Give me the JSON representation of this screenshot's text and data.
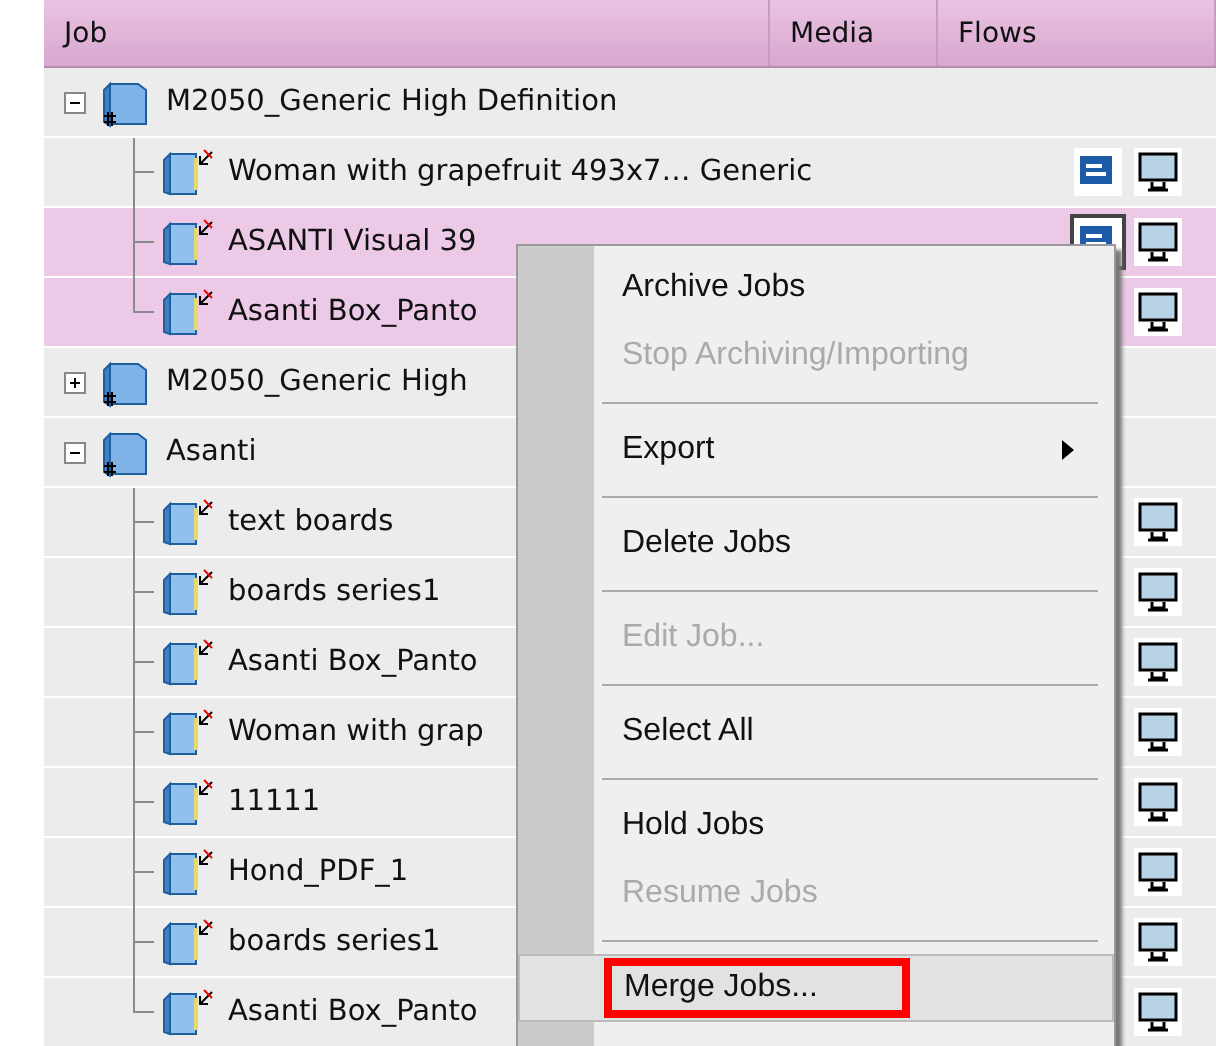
{
  "table": {
    "columns": [
      {
        "label": "Job"
      },
      {
        "label": "Media"
      },
      {
        "label": "Flows"
      }
    ],
    "rows": [
      {
        "name": "M2050_Generic High Definition",
        "expanded": true,
        "selected": false,
        "children": [
          {
            "name": "Woman with grapefruit 493x7… Generic",
            "selected": false,
            "flows": [
              {
                "kind": "ticket",
                "focused": false
              },
              {
                "kind": "monitor"
              }
            ]
          },
          {
            "name": "ASANTI Visual 39",
            "selected": true,
            "flows": [
              {
                "kind": "ticket",
                "focused": true
              },
              {
                "kind": "monitor"
              }
            ]
          },
          {
            "name": "Asanti Box_Panto",
            "selected": true,
            "flows": [
              {
                "kind": "monitor"
              }
            ]
          }
        ]
      },
      {
        "name": "M2050_Generic High",
        "expanded": false,
        "selected": false
      },
      {
        "name": "Asanti",
        "expanded": true,
        "selected": false,
        "children": [
          {
            "name": "text boards",
            "selected": false,
            "flows": [
              {
                "kind": "monitor"
              }
            ]
          },
          {
            "name": "boards series1",
            "selected": false,
            "flows": [
              {
                "kind": "monitor"
              }
            ]
          },
          {
            "name": "Asanti Box_Panto",
            "selected": false,
            "flows": [
              {
                "kind": "monitor"
              }
            ]
          },
          {
            "name": "Woman with grap",
            "selected": false,
            "flows": [
              {
                "kind": "monitor"
              }
            ]
          },
          {
            "name": "11111",
            "selected": false,
            "flows": [
              {
                "kind": "monitor"
              }
            ]
          },
          {
            "name": "Hond_PDF_1",
            "selected": false,
            "flows": [
              {
                "kind": "monitor"
              }
            ]
          },
          {
            "name": "boards series1",
            "selected": false,
            "flows": [
              {
                "kind": "monitor"
              }
            ]
          },
          {
            "name": "Asanti Box_Panto",
            "selected": false,
            "flows": [
              {
                "kind": "monitor"
              }
            ]
          }
        ]
      }
    ]
  },
  "context_menu": {
    "items": [
      {
        "kind": "item",
        "label": "Archive Jobs",
        "disabled": false,
        "submenu": false,
        "highlighted": false
      },
      {
        "kind": "item",
        "label": "Stop Archiving/Importing",
        "disabled": true,
        "submenu": false,
        "highlighted": false
      },
      {
        "kind": "separator"
      },
      {
        "kind": "item",
        "label": "Export",
        "disabled": false,
        "submenu": true,
        "highlighted": false
      },
      {
        "kind": "separator"
      },
      {
        "kind": "item",
        "label": "Delete Jobs",
        "disabled": false,
        "submenu": false,
        "highlighted": false
      },
      {
        "kind": "separator"
      },
      {
        "kind": "item",
        "label": "Edit Job...",
        "disabled": true,
        "submenu": false,
        "highlighted": false
      },
      {
        "kind": "separator"
      },
      {
        "kind": "item",
        "label": "Select All",
        "disabled": false,
        "submenu": false,
        "highlighted": false
      },
      {
        "kind": "separator"
      },
      {
        "kind": "item",
        "label": "Hold Jobs",
        "disabled": false,
        "submenu": false,
        "highlighted": false
      },
      {
        "kind": "item",
        "label": "Resume Jobs",
        "disabled": true,
        "submenu": false,
        "highlighted": false
      },
      {
        "kind": "separator"
      },
      {
        "kind": "item",
        "label": "Merge Jobs...",
        "disabled": false,
        "submenu": false,
        "highlighted": true
      }
    ]
  }
}
